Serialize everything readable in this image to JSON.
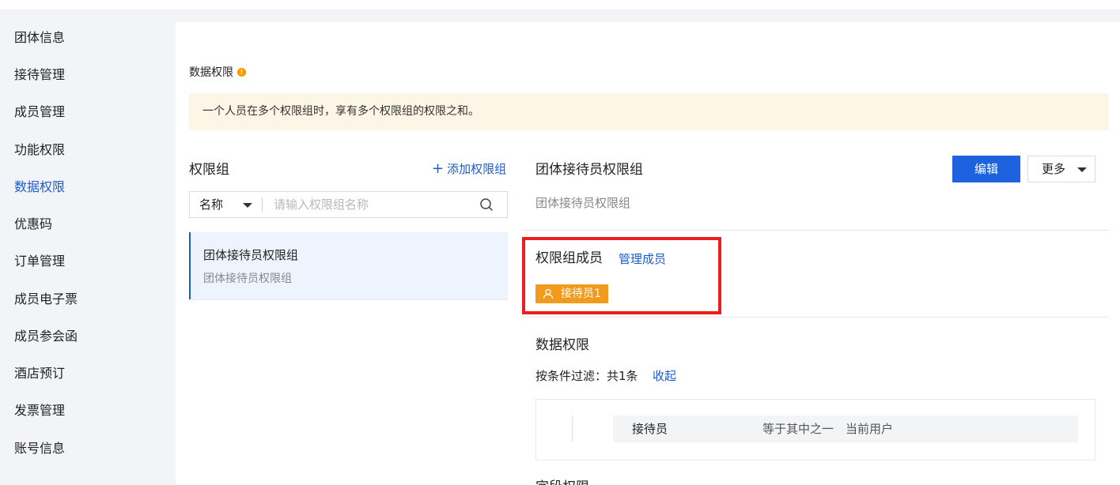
{
  "sidebar": {
    "items": [
      {
        "label": "团体信息"
      },
      {
        "label": "接待管理"
      },
      {
        "label": "成员管理"
      },
      {
        "label": "功能权限"
      },
      {
        "label": "数据权限",
        "active": true
      },
      {
        "label": "优惠码"
      },
      {
        "label": "订单管理"
      },
      {
        "label": "成员电子票"
      },
      {
        "label": "成员参会函"
      },
      {
        "label": "酒店预订"
      },
      {
        "label": "发票管理"
      },
      {
        "label": "账号信息"
      }
    ]
  },
  "page": {
    "title": "数据权限",
    "notice": "一个人员在多个权限组时，享有多个权限组的权限之和。"
  },
  "group_panel": {
    "title": "权限组",
    "add_label": "添加权限组",
    "search": {
      "field_label": "名称",
      "placeholder": "请输入权限组名称"
    },
    "groups": [
      {
        "name": "团体接待员权限组",
        "desc": "团体接待员权限组",
        "selected": true
      }
    ]
  },
  "detail": {
    "title": "团体接待员权限组",
    "desc": "团体接待员权限组",
    "edit_label": "编辑",
    "more_label": "更多",
    "members": {
      "title": "权限组成员",
      "manage_label": "管理成员",
      "tags": [
        {
          "label": "接待员1"
        }
      ]
    },
    "data_permission": {
      "title": "数据权限",
      "filter_summary": "按条件过滤：共1条",
      "collapse_label": "收起",
      "conditions": [
        {
          "field": "接待员",
          "operator": "等于其中之一",
          "value": "当前用户"
        }
      ]
    },
    "next_section_title": "字段权限"
  },
  "colors": {
    "accent": "#1f62e0",
    "link": "#1d5ccf",
    "notice_bg": "#fdf6e7",
    "tag_orange": "#f29a1c",
    "highlight_red": "#f01d1d"
  }
}
